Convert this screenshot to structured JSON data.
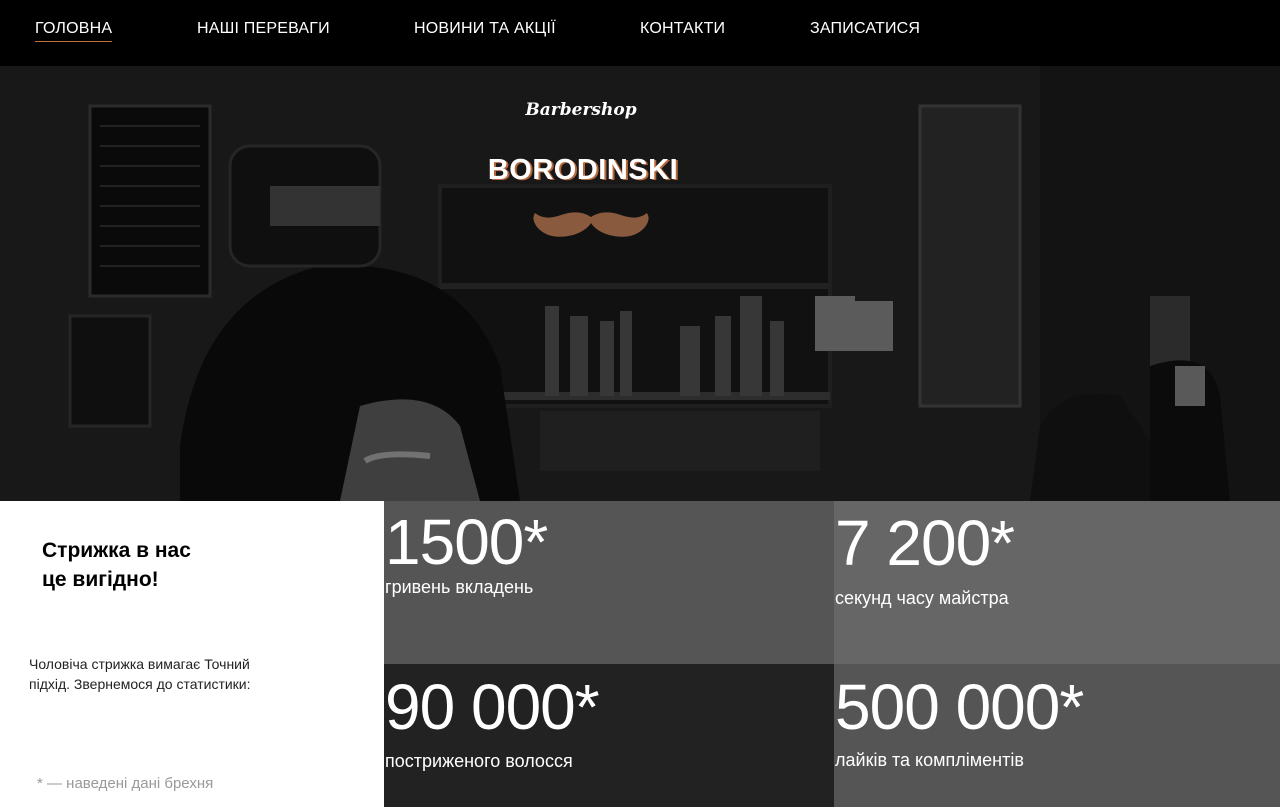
{
  "nav": {
    "items": [
      {
        "label": "ГОЛОВНА",
        "active": true
      },
      {
        "label": "НАШІ ПЕРЕВАГИ",
        "active": false
      },
      {
        "label": "НОВИНИ ТА АКЦІЇ",
        "active": false
      },
      {
        "label": "КОНТАКТИ",
        "active": false
      },
      {
        "label": "ЗАПИСАТИСЯ",
        "active": false
      }
    ]
  },
  "hero": {
    "subtitle": "Barbershop",
    "title": "BORODINSKI",
    "moustache_color": "#8a5a3e",
    "title_shadow_color": "#b8673a"
  },
  "info": {
    "heading_line1": "Стрижка в нас",
    "heading_line2": "це вигідно!",
    "text": "Чоловіча стрижка вимагає Точний підхід. Звернемося до статистики:",
    "note": "* — наведені дані брехня"
  },
  "stats": [
    {
      "value": "1500*",
      "label": "гривень вкладень"
    },
    {
      "value": "7 200*",
      "label": "секунд часу майстра"
    },
    {
      "value": "90 000*",
      "label": "постриженого волосся"
    },
    {
      "value": "500 000*",
      "label": "лайків та компліментів"
    }
  ],
  "colors": {
    "accent": "#c0743a",
    "stat_bg_1": "#555555",
    "stat_bg_2": "#666666",
    "stat_bg_3": "#222222"
  }
}
